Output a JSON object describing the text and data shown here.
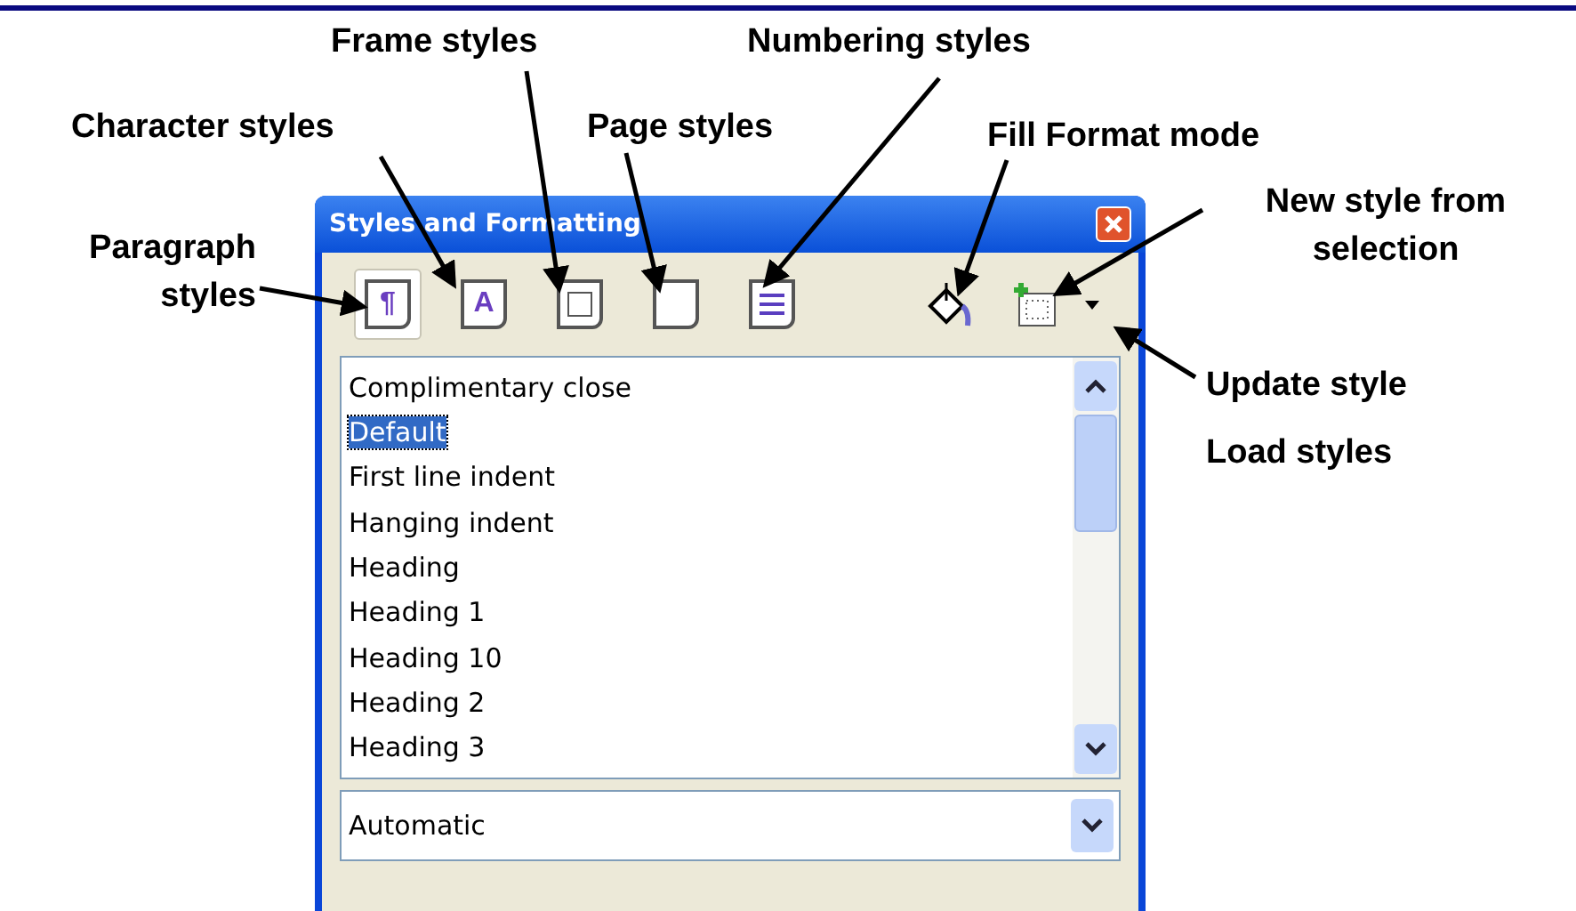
{
  "annotations": [
    {
      "label": "Frame styles"
    },
    {
      "label": "Numbering styles"
    },
    {
      "label": "Character styles"
    },
    {
      "label": "Page styles"
    },
    {
      "label": "Fill Format mode"
    },
    {
      "label": "Paragraph styles"
    },
    {
      "label": "New style from selection"
    },
    {
      "label": "Update style"
    },
    {
      "label": "Load styles"
    }
  ],
  "window": {
    "title": "Styles and Formatting",
    "tabs": [
      {
        "kind": "paragraph",
        "glyph": "¶",
        "selected": true
      },
      {
        "kind": "character",
        "glyph": "A",
        "selected": false
      },
      {
        "kind": "frame",
        "selected": false
      },
      {
        "kind": "page",
        "selected": false
      },
      {
        "kind": "numbering",
        "selected": false
      }
    ],
    "styles": [
      {
        "name": "Complimentary close",
        "selected": false
      },
      {
        "name": "Default",
        "selected": true
      },
      {
        "name": "First line indent",
        "selected": false
      },
      {
        "name": "Hanging indent",
        "selected": false
      },
      {
        "name": "Heading",
        "selected": false
      },
      {
        "name": "Heading 1",
        "selected": false
      },
      {
        "name": "Heading 10",
        "selected": false
      },
      {
        "name": "Heading 2",
        "selected": false
      },
      {
        "name": "Heading 3",
        "selected": false
      }
    ],
    "filter": {
      "value": "Automatic"
    }
  }
}
